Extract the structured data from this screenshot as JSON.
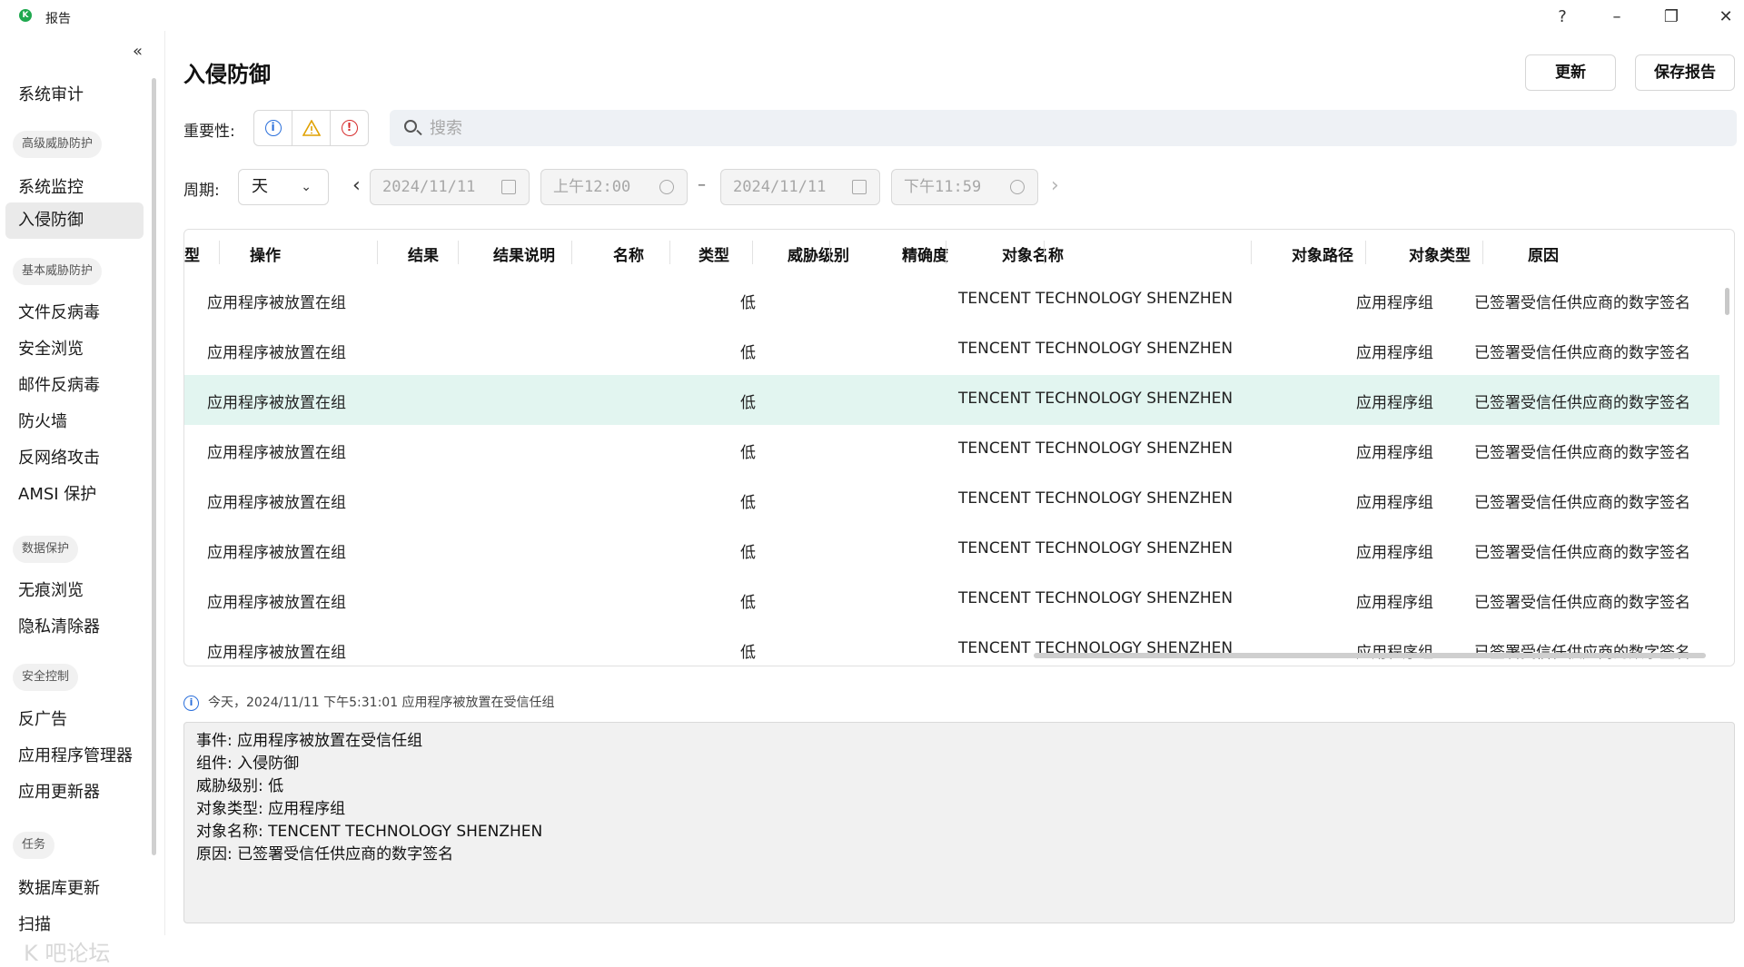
{
  "window": {
    "title": "报告",
    "help": "?",
    "minimize": "–",
    "restore": "❐",
    "close": "✕"
  },
  "sidebar": {
    "collapse": "«",
    "items": [
      {
        "label": "系统审计",
        "type": "item"
      },
      {
        "label": "高级威胁防护",
        "type": "group"
      },
      {
        "label": "系统监控",
        "type": "item"
      },
      {
        "label": "入侵防御",
        "type": "item",
        "active": true
      },
      {
        "label": "基本威胁防护",
        "type": "group"
      },
      {
        "label": "文件反病毒",
        "type": "item"
      },
      {
        "label": "安全浏览",
        "type": "item"
      },
      {
        "label": "邮件反病毒",
        "type": "item"
      },
      {
        "label": "防火墙",
        "type": "item"
      },
      {
        "label": "反网络攻击",
        "type": "item"
      },
      {
        "label": "AMSI 保护",
        "type": "item"
      },
      {
        "label": "数据保护",
        "type": "group"
      },
      {
        "label": "无痕浏览",
        "type": "item"
      },
      {
        "label": "隐私清除器",
        "type": "item"
      },
      {
        "label": "安全控制",
        "type": "group"
      },
      {
        "label": "反广告",
        "type": "item"
      },
      {
        "label": "应用程序管理器",
        "type": "item"
      },
      {
        "label": "应用更新器",
        "type": "item"
      },
      {
        "label": "任务",
        "type": "group"
      },
      {
        "label": "数据库更新",
        "type": "item"
      },
      {
        "label": "扫描",
        "type": "item"
      }
    ],
    "watermark": "K 吧论坛"
  },
  "header": {
    "title": "入侵防御",
    "update_label": "更新",
    "save_label": "保存报告"
  },
  "filters": {
    "severity_label": "重要性:",
    "severity_icons": [
      "info-icon",
      "warning-icon",
      "critical-icon"
    ],
    "severity_colors": {
      "info": "#2a6fdb",
      "warning": "#e0a100",
      "critical": "#d62c2c"
    },
    "search_placeholder": "搜索",
    "period_label": "周期:",
    "period_value": "天",
    "start_date": "2024/11/11",
    "start_time": "上午12:00",
    "end_date": "2024/11/11",
    "end_time": "下午11:59",
    "range_sep": "–",
    "prev": "‹",
    "next": "›"
  },
  "table": {
    "columns": [
      "型",
      "操作",
      "结果",
      "结果说明",
      "名称",
      "类型",
      "威胁级别",
      "精确度",
      "对象名称",
      "对象路径",
      "对象类型",
      "原因"
    ],
    "rows": [
      {
        "action": "应用程序被放置在组",
        "level": "低",
        "object_name": "TENCENT TECHNOLOGY SHENZHEN",
        "object_type": "应用程序组",
        "reason": "已签署受信任供应商的数字签名"
      },
      {
        "action": "应用程序被放置在组",
        "level": "低",
        "object_name": "TENCENT TECHNOLOGY SHENZHEN",
        "object_type": "应用程序组",
        "reason": "已签署受信任供应商的数字签名"
      },
      {
        "action": "应用程序被放置在组",
        "level": "低",
        "object_name": "TENCENT TECHNOLOGY SHENZHEN",
        "object_type": "应用程序组",
        "reason": "已签署受信任供应商的数字签名",
        "selected": true
      },
      {
        "action": "应用程序被放置在组",
        "level": "低",
        "object_name": "TENCENT TECHNOLOGY SHENZHEN",
        "object_type": "应用程序组",
        "reason": "已签署受信任供应商的数字签名"
      },
      {
        "action": "应用程序被放置在组",
        "level": "低",
        "object_name": "TENCENT TECHNOLOGY SHENZHEN",
        "object_type": "应用程序组",
        "reason": "已签署受信任供应商的数字签名"
      },
      {
        "action": "应用程序被放置在组",
        "level": "低",
        "object_name": "TENCENT TECHNOLOGY SHENZHEN",
        "object_type": "应用程序组",
        "reason": "已签署受信任供应商的数字签名"
      },
      {
        "action": "应用程序被放置在组",
        "level": "低",
        "object_name": "TENCENT TECHNOLOGY SHENZHEN",
        "object_type": "应用程序组",
        "reason": "已签署受信任供应商的数字签名"
      },
      {
        "action": "应用程序被放置在组",
        "level": "低",
        "object_name": "TENCENT TECHNOLOGY SHENZHEN",
        "object_type": "应用程序组",
        "reason": "已签署受信任供应商的数字签名"
      }
    ]
  },
  "details": {
    "summary": "今天，2024/11/11 下午5:31:01 应用程序被放置在受信任组",
    "lines": [
      "事件: 应用程序被放置在受信任组",
      "组件: 入侵防御",
      "威胁级别: 低",
      "对象类型: 应用程序组",
      "对象名称: TENCENT TECHNOLOGY SHENZHEN",
      "原因: 已签署受信任供应商的数字签名"
    ]
  }
}
